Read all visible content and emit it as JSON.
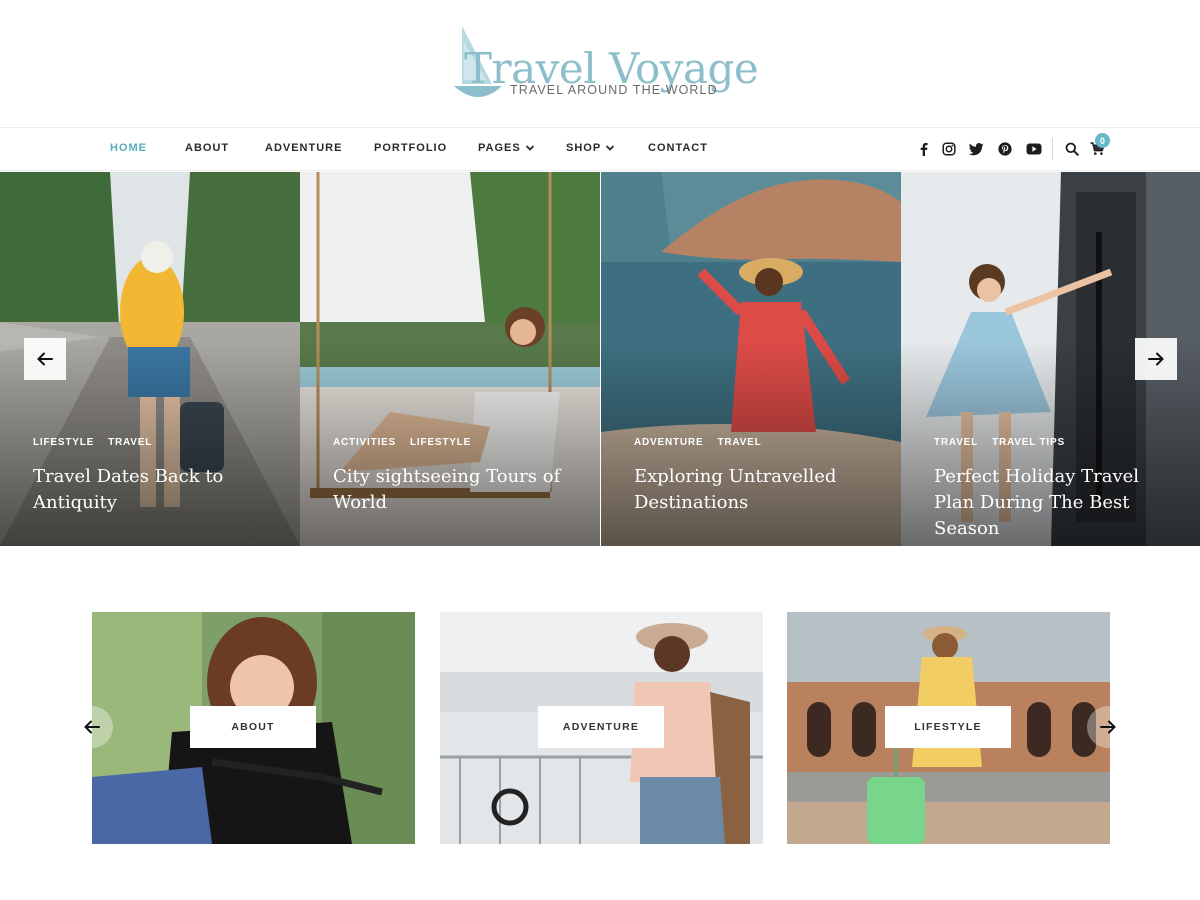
{
  "logo": {
    "title": "Travel Voyage",
    "tagline": "TRAVEL AROUND THE WORLD",
    "color": "#8cbfcb"
  },
  "nav": {
    "items": [
      {
        "label": "HOME",
        "active": true
      },
      {
        "label": "ABOUT"
      },
      {
        "label": "ADVENTURE"
      },
      {
        "label": "PORTFOLIO"
      },
      {
        "label": "PAGES",
        "dropdown": true
      },
      {
        "label": "SHOP",
        "dropdown": true
      },
      {
        "label": "CONTACT"
      }
    ],
    "social_icons": [
      "facebook-icon",
      "instagram-icon",
      "twitter-icon",
      "pinterest-icon",
      "youtube-icon"
    ],
    "search_icon": "search-icon",
    "cart_icon": "cart-icon",
    "cart_count": "0",
    "accent_color": "#5aaebb"
  },
  "slider": {
    "slides": [
      {
        "categories": [
          "LIFESTYLE",
          "TRAVEL"
        ],
        "title": "Travel Dates Back to Antiquity"
      },
      {
        "categories": [
          "ACTIVITIES",
          "LIFESTYLE"
        ],
        "title": "City sightseeing Tours of World"
      },
      {
        "categories": [
          "ADVENTURE",
          "TRAVEL"
        ],
        "title": "Exploring Untravelled Destinations"
      },
      {
        "categories": [
          "TRAVEL",
          "TRAVEL TIPS"
        ],
        "title": "Perfect Holiday Travel Plan During The Best Season"
      }
    ],
    "prev_icon": "arrow-left-icon",
    "next_icon": "arrow-right-icon"
  },
  "category_cards": {
    "cards": [
      {
        "label": "ABOUT"
      },
      {
        "label": "ADVENTURE"
      },
      {
        "label": "LIFESTYLE"
      }
    ],
    "prev_icon": "arrow-left-icon",
    "next_icon": "arrow-right-icon"
  }
}
